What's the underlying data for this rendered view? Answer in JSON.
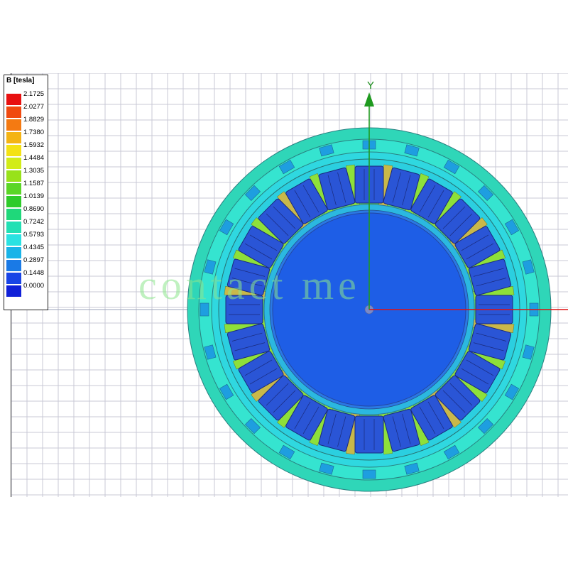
{
  "legend": {
    "title": "B [tesla]",
    "ticks": [
      "2.1725",
      "2.0277",
      "1.8829",
      "1.7380",
      "1.5932",
      "1.4484",
      "1.3035",
      "1.1587",
      "1.0139",
      "0.8690",
      "0.7242",
      "0.5793",
      "0.4345",
      "0.2897",
      "0.1448",
      "0.0000"
    ],
    "colors": [
      "#e81010",
      "#f04a10",
      "#f47a12",
      "#f4b414",
      "#f4e214",
      "#d2ec18",
      "#98e21a",
      "#5ad626",
      "#2ecb2a",
      "#1fd87a",
      "#22e0b4",
      "#2ae2e2",
      "#19b4e8",
      "#1a7ae6",
      "#1844e6",
      "#1020d8"
    ]
  },
  "axis": {
    "y_label": "Y"
  },
  "watermark": "contact me",
  "colors": {
    "axis_y": "#1f9a1f",
    "axis_x": "#e01010",
    "grid": "#c9c9d6",
    "stator_yoke": "#2ee0cc",
    "tooth_field": "#2cd8d8",
    "rotor_core": "#1e5ee6",
    "coil": "#2a55d6",
    "coil_border": "#1a2a7a"
  },
  "slots_count": 24
}
